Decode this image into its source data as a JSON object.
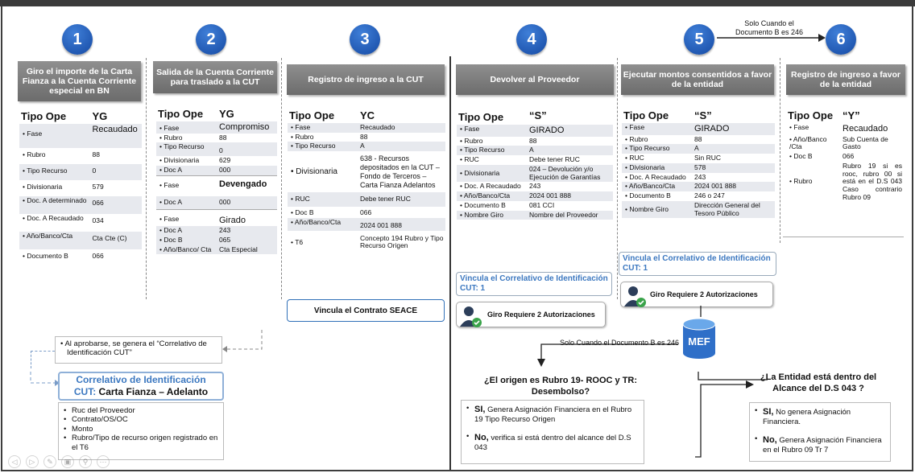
{
  "steps": [
    {
      "num": "1",
      "title": "Giro el importe de la Carta Fianza a la Cuenta Corriente especial en BN"
    },
    {
      "num": "2",
      "title": "Salida de la Cuenta Corriente para traslado a la CUT"
    },
    {
      "num": "3",
      "title": "Registro de ingreso a la CUT"
    },
    {
      "num": "4",
      "title": "Devolver al Proveedor"
    },
    {
      "num": "5",
      "title": "Ejecutar montos consentidos a favor de la entidad"
    },
    {
      "num": "6",
      "title": "Registro de ingreso a favor de la entidad"
    }
  ],
  "note_top": "Solo Cuando el Documento B es 246",
  "note_mid": "Solo Cuando el Documento B es 246",
  "col1": {
    "head_k": "Tipo Ope",
    "head_v": "YG",
    "rows": [
      [
        "Fase",
        "Recaudado"
      ],
      [
        "Rubro",
        "88"
      ],
      [
        "Tipo Recurso",
        "0"
      ],
      [
        "Divisionaria",
        "579"
      ],
      [
        "Doc. A determinado",
        "066"
      ],
      [
        "Doc. A Recaudado",
        "034"
      ],
      [
        "Año/Banco/Cta",
        "Cta Cte (C)"
      ],
      [
        "Documento B",
        "066"
      ]
    ]
  },
  "col2": {
    "head_k": "Tipo Ope",
    "head_v": "YG",
    "g1": [
      [
        "Fase",
        "Compromiso"
      ],
      [
        "Rubro",
        "88"
      ],
      [
        "Tipo Recurso",
        "0"
      ],
      [
        "Divisionaria",
        "629"
      ],
      [
        "Doc A",
        "000"
      ]
    ],
    "g2": [
      [
        "Fase",
        "Devengado"
      ],
      [
        "Doc A",
        "000"
      ]
    ],
    "g3": [
      [
        "Fase",
        "Girado"
      ],
      [
        "Doc A",
        "243"
      ],
      [
        "Doc B",
        "065"
      ],
      [
        "Año/Banco/ Cta",
        "Cta Especial"
      ]
    ]
  },
  "col3": {
    "head_k": "Tipo Ope",
    "head_v": "YC",
    "rows": [
      [
        "Fase",
        "Recaudado"
      ],
      [
        "Rubro",
        "88"
      ],
      [
        "Tipo Recurso",
        "A"
      ],
      [
        "Divisionaria",
        "638 - Recursos depositados en la CUT – Fondo de Terceros – Carta Fianza Adelantos"
      ],
      [
        "RUC",
        "Debe tener RUC"
      ],
      [
        "Doc B",
        "066"
      ],
      [
        "Año/Banco/Cta",
        "2024 001 888"
      ],
      [
        "T6",
        "Concepto 194 Rubro y Tipo Recurso Origen"
      ]
    ],
    "contract": "Vincula el Contrato SEACE"
  },
  "col4": {
    "head_k": "Tipo Ope",
    "head_v": "“S”",
    "rows": [
      [
        "Fase",
        "GIRADO"
      ],
      [
        "Rubro",
        "88"
      ],
      [
        "Tipo Recurso",
        "A"
      ],
      [
        "RUC",
        "Debe tener RUC"
      ],
      [
        "Divisionaria",
        "024 – Devolución y/o Ejecución de Garantías"
      ],
      [
        "Doc. A Recaudado",
        "243"
      ],
      [
        "Año/Banco/Cta",
        "2024 001 888"
      ],
      [
        "Documento B",
        "081 CCI"
      ],
      [
        "Nombre Giro",
        "Nombre del Proveedor"
      ]
    ],
    "vincula": "Vincula el Correlativo de Identificación CUT: 1",
    "auth": "Giro  Requiere 2 Autorizaciones"
  },
  "col5": {
    "head_k": "Tipo Ope",
    "head_v": "“S”",
    "rows": [
      [
        "Fase",
        "GIRADO"
      ],
      [
        "Rubro",
        "88"
      ],
      [
        "Tipo Recurso",
        "A"
      ],
      [
        "RUC",
        "Sin RUC"
      ],
      [
        "Divisionaria",
        "578"
      ],
      [
        "Doc. A Recaudado",
        "243"
      ],
      [
        "Año/Banco/Cta",
        "2024 001 888"
      ],
      [
        "Documento B",
        "246 o 247"
      ],
      [
        "Nombre Giro",
        "Dirección General del Tesoro Público"
      ]
    ],
    "vincula": "Vincula el Correlativo de Identificación CUT: 1",
    "auth": "Giro  Requiere 2 Autorizaciones"
  },
  "col6": {
    "head_k": "Tipo Ope",
    "head_v": "“Y”",
    "rows": [
      [
        "Fase",
        "Recaudado"
      ],
      [
        "Año/Banco /Cta",
        "Sub Cuenta de Gasto"
      ],
      [
        "Doc B",
        "066"
      ],
      [
        "Rubro",
        "Rubro 19 si es rooc, rubro 00 si está en el D.S 043 Caso contrario Rubro 09"
      ]
    ]
  },
  "approve_note": "Al aprobarse, se genera el “Correlativo de Identificación CUT”",
  "correlativo": {
    "title_a": "Correlativo de Identificación",
    "title_b": "CUT:",
    "title_c": "Carta Fianza – Adelanto",
    "items": [
      "Ruc del Proveedor",
      "Contrato/OS/OC",
      "Monto",
      "Rubro/Tipo de recurso origen registrado en el T6"
    ]
  },
  "mef": "MEF",
  "q1": "¿El origen es Rubro 19- ROOC y TR: Desembolso?",
  "q1_si_b": "SI,",
  "q1_si": " Genera Asignación Financiera en el Rubro 19 Tipo Recurso Origen",
  "q1_no_b": "No,",
  "q1_no": " verifica si está dentro del alcance del D.S 043",
  "q2": "¿La Entidad está dentro del Alcance del D.S 043 ?",
  "q2_si_b": "SI,",
  "q2_si": " No genera Asignación Financiera.",
  "q2_no_b": "No,",
  "q2_no": " Genera Asignación Financiera en el Rubro 09 Tr 7",
  "colors": {
    "accent": "#1f5fbf",
    "header": "#7a7a7a",
    "blue_text": "#3c78c0"
  }
}
